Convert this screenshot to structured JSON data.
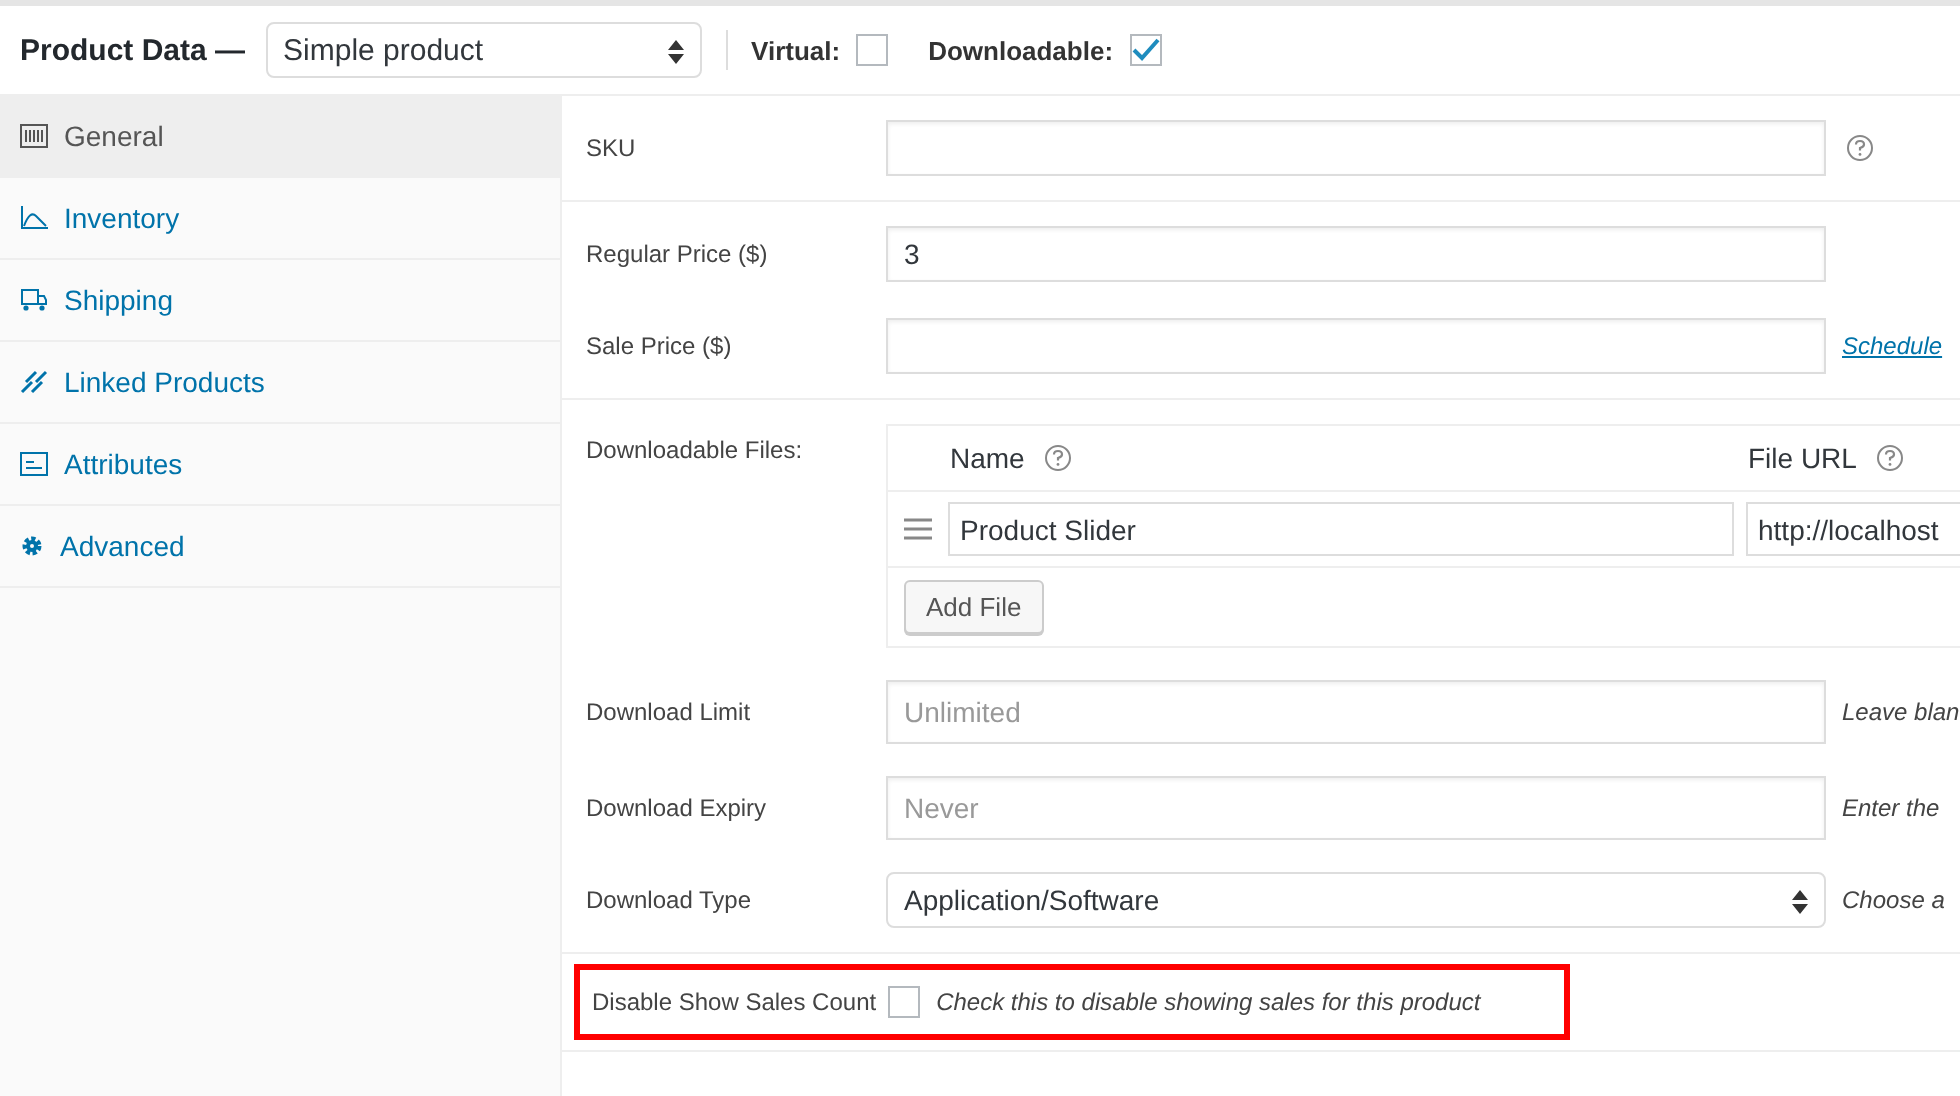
{
  "header": {
    "title": "Product Data —",
    "product_type": "Simple product",
    "virtual": {
      "label": "Virtual:",
      "checked": false
    },
    "downloadable": {
      "label": "Downloadable:",
      "checked": true
    }
  },
  "tabs": [
    {
      "label": "General",
      "selected": true
    },
    {
      "label": "Inventory",
      "selected": false
    },
    {
      "label": "Shipping",
      "selected": false
    },
    {
      "label": "Linked Products",
      "selected": false
    },
    {
      "label": "Attributes",
      "selected": false
    },
    {
      "label": "Advanced",
      "selected": false
    }
  ],
  "sku": {
    "label": "SKU"
  },
  "regular_price": {
    "label": "Regular Price ($)",
    "value": "3"
  },
  "sale_price": {
    "label": "Sale Price ($)",
    "link": "Schedule"
  },
  "downloadable_files": {
    "label": "Downloadable Files:",
    "columns": [
      "Name",
      "File URL"
    ],
    "rows": [
      {
        "name": "Product Slider",
        "url": "http://localhost"
      }
    ],
    "add_button": "Add File"
  },
  "download_limit": {
    "label": "Download Limit",
    "placeholder": "Unlimited",
    "note": "Leave blan"
  },
  "download_expiry": {
    "label": "Download Expiry",
    "placeholder": "Never",
    "note": "Enter the"
  },
  "download_type": {
    "label": "Download Type",
    "value": "Application/Software",
    "note": "Choose a"
  },
  "disable_sales_count": {
    "label": "Disable Show Sales Count",
    "checked": false,
    "description": "Check this to disable showing sales for this product",
    "highlighted": true
  }
}
